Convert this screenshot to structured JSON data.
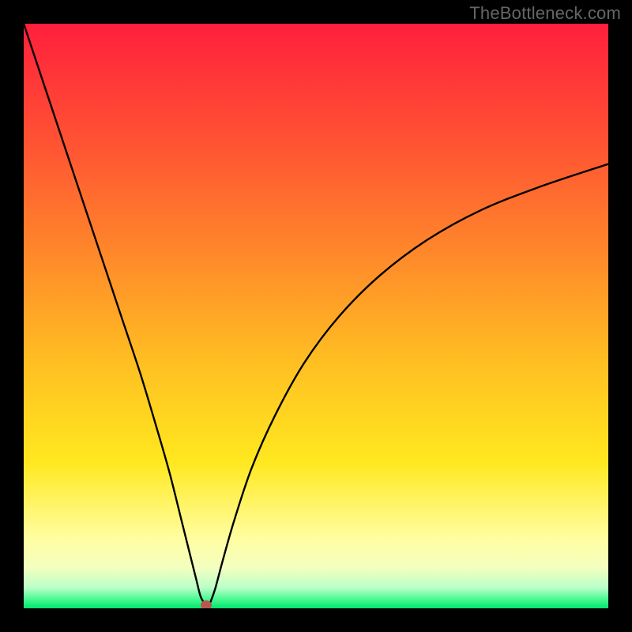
{
  "watermark": "TheBottleneck.com",
  "chart_data": {
    "type": "line",
    "title": "",
    "xlabel": "",
    "ylabel": "",
    "xlim": [
      0,
      100
    ],
    "ylim": [
      0,
      100
    ],
    "background_gradient": {
      "type": "vertical",
      "stops": [
        {
          "pos": 0.0,
          "color": "#ff1f3c"
        },
        {
          "pos": 0.22,
          "color": "#ff5732"
        },
        {
          "pos": 0.4,
          "color": "#ff8a2a"
        },
        {
          "pos": 0.58,
          "color": "#ffbf22"
        },
        {
          "pos": 0.75,
          "color": "#ffe81f"
        },
        {
          "pos": 0.88,
          "color": "#fffea0"
        },
        {
          "pos": 0.93,
          "color": "#f4ffbf"
        },
        {
          "pos": 0.965,
          "color": "#b9ffc8"
        },
        {
          "pos": 0.985,
          "color": "#46f98f"
        },
        {
          "pos": 1.0,
          "color": "#00e56f"
        }
      ]
    },
    "series": [
      {
        "name": "bottleneck-curve",
        "x": [
          0,
          2,
          5,
          8,
          11,
          14,
          17,
          20,
          23,
          25,
          27,
          28.5,
          29.5,
          30.2,
          30.8,
          31.2,
          31.6,
          32,
          32.8,
          34,
          36,
          39,
          43,
          48,
          54,
          61,
          69,
          78,
          88,
          100
        ],
        "y": [
          100,
          94,
          85,
          76,
          67,
          58,
          49,
          40,
          30,
          23,
          15,
          9,
          5,
          2.2,
          1.0,
          0.5,
          0.5,
          1.2,
          3.5,
          8,
          15,
          24,
          33,
          42,
          50,
          57,
          63,
          68,
          72,
          76
        ]
      }
    ],
    "marker": {
      "x": 31.2,
      "y": 0.5,
      "color": "#b9564f"
    },
    "colors": {
      "curve": "#000000",
      "frame_background": "#000000"
    }
  }
}
